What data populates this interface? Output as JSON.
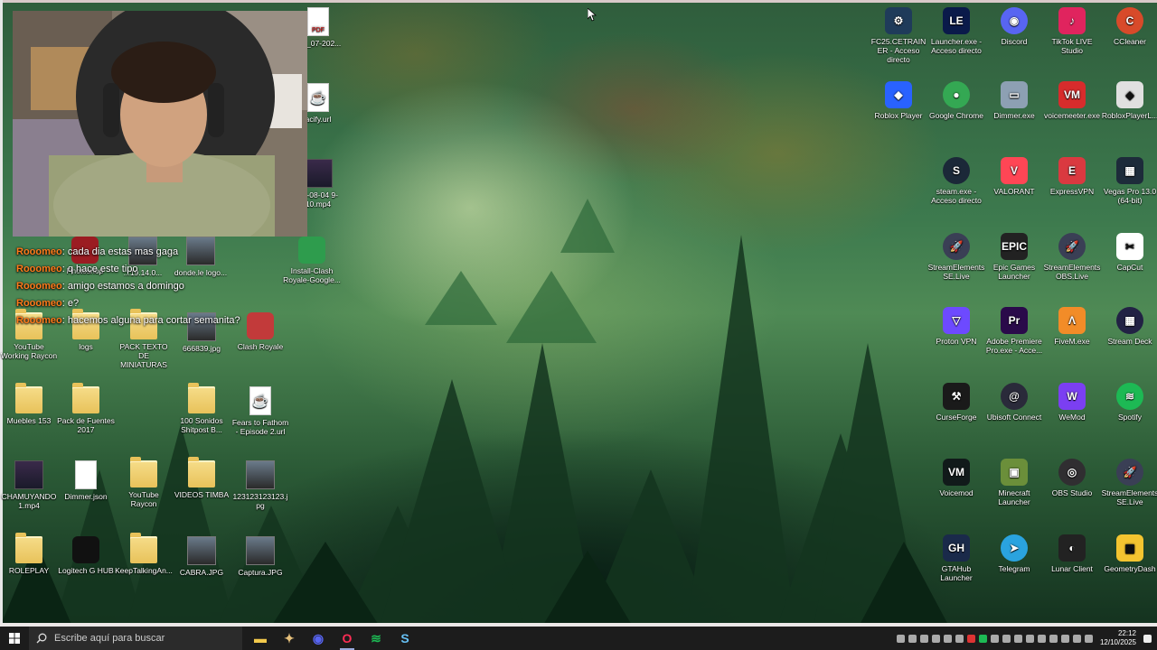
{
  "desktop": {
    "left_icons": [
      {
        "label": "ura_07-202...",
        "kind": "pdf",
        "badge": "PDF"
      },
      {
        "label": "acify.url",
        "kind": "java"
      },
      {
        "label": "25-08-04\n9-10.mp4",
        "kind": "video"
      },
      {
        "label": "Install-Clash Royale-Google...",
        "kind": "app",
        "color": "#2e9c4d"
      },
      {
        "label": "Photoshop",
        "kind": "app",
        "color": "#9b1c22"
      },
      {
        "label": "...19.14.0...",
        "kind": "image"
      },
      {
        "label": "donde.le logo...",
        "kind": "image"
      },
      {
        "label": "YouTube Working Raycon",
        "kind": "folder"
      },
      {
        "label": "logs",
        "kind": "folder"
      },
      {
        "label": "PACK TEXTO DE MINIATURAS",
        "kind": "folder"
      },
      {
        "label": "666839.jpg",
        "kind": "image"
      },
      {
        "label": "Clash Royale",
        "kind": "app",
        "color": "#c23a3a"
      },
      {
        "label": "Muebles 153",
        "kind": "folder"
      },
      {
        "label": "Pack de Fuentes 2017",
        "kind": "folder"
      },
      {
        "label": "100 Sonidos Shitpost B...",
        "kind": "folder"
      },
      {
        "label": "Fears to Fathom - Episode 2.url",
        "kind": "java"
      },
      {
        "label": "CHAMUYANDO 1.mp4",
        "kind": "video"
      },
      {
        "label": "Dimmer.json",
        "kind": "file"
      },
      {
        "label": "YouTube Raycon",
        "kind": "folder"
      },
      {
        "label": "VIDEOS TIMBA",
        "kind": "folder"
      },
      {
        "label": "123123123123.jpg",
        "kind": "image"
      },
      {
        "label": "ROLEPLAY",
        "kind": "folder"
      },
      {
        "label": "Logitech G HUB",
        "kind": "app",
        "color": "#111111"
      },
      {
        "label": "KeepTalkingAn...",
        "kind": "folder"
      },
      {
        "label": "CABRA.JPG",
        "kind": "image"
      },
      {
        "label": "Captura.JPG",
        "kind": "image"
      }
    ],
    "right_icons": [
      {
        "label": "FC25.CETRAINER - Acceso directo",
        "kind": "app",
        "color": "#1f3b5a",
        "badge": "⚙"
      },
      {
        "label": "Launcher.exe - Acceso directo",
        "kind": "app",
        "color": "#0a1a4a",
        "badge": "LE"
      },
      {
        "label": "Discord",
        "kind": "round",
        "color": "#5865F2",
        "badge": "◉"
      },
      {
        "label": "TikTok LIVE Studio",
        "kind": "app",
        "color": "#e0245e",
        "badge": "♪"
      },
      {
        "label": "CCleaner",
        "kind": "round",
        "color": "#d84a2a",
        "badge": "C"
      },
      {
        "label": "Roblox Player",
        "kind": "app",
        "color": "#2962ff",
        "badge": "◆"
      },
      {
        "label": "Google Chrome",
        "kind": "round",
        "color": "#34a853",
        "badge": "●"
      },
      {
        "label": "Dimmer.exe",
        "kind": "app",
        "color": "#8da0b3",
        "badge": "▭"
      },
      {
        "label": "voicemeeter.exe",
        "kind": "app",
        "color": "#d72c2c",
        "badge": "VM"
      },
      {
        "label": "RobloxPlayerL...",
        "kind": "app",
        "color": "#e0e0e0",
        "badge": "◆"
      },
      {
        "label": "steam.exe - Acceso directo",
        "kind": "round",
        "color": "#1b2838",
        "badge": "S"
      },
      {
        "label": "VALORANT",
        "kind": "app",
        "color": "#ff4655",
        "badge": "V"
      },
      {
        "label": "ExpressVPN",
        "kind": "app",
        "color": "#da3940",
        "badge": "E"
      },
      {
        "label": "Vegas Pro 13.0 (64-bit)",
        "kind": "app",
        "color": "#1d2b3a",
        "badge": "▦"
      },
      {
        "label": "StreamElements SE.Live",
        "kind": "round",
        "color": "#3a3f55",
        "badge": "🚀"
      },
      {
        "label": "Epic Games Launcher",
        "kind": "app",
        "color": "#222222",
        "badge": "EPIC"
      },
      {
        "label": "StreamElements OBS.Live",
        "kind": "round",
        "color": "#3a3f55",
        "badge": "🚀"
      },
      {
        "label": "CapCut",
        "kind": "app",
        "color": "#ffffff",
        "badge": "✂"
      },
      {
        "label": "Proton VPN",
        "kind": "app",
        "color": "#6d4aff",
        "badge": "▽"
      },
      {
        "label": "Adobe Premiere Pro.exe - Acce...",
        "kind": "app",
        "color": "#2a0a4a",
        "badge": "Pr"
      },
      {
        "label": "FiveM.exe",
        "kind": "app",
        "color": "#f28c28",
        "badge": "Λ"
      },
      {
        "label": "Stream Deck",
        "kind": "round",
        "color": "#222244",
        "badge": "▦"
      },
      {
        "label": "CurseForge",
        "kind": "app",
        "color": "#1a1a1a",
        "badge": "⚒"
      },
      {
        "label": "Ubisoft Connect",
        "kind": "round",
        "color": "#2a2a3a",
        "badge": "@"
      },
      {
        "label": "WeMod",
        "kind": "app",
        "color": "#7b3ff2",
        "badge": "W"
      },
      {
        "label": "Spotify",
        "kind": "round",
        "color": "#1db954",
        "badge": "≋"
      },
      {
        "label": "Voicemod",
        "kind": "app",
        "color": "#111a1a",
        "badge": "VM"
      },
      {
        "label": "Minecraft Launcher",
        "kind": "app",
        "color": "#6b8f3a",
        "badge": "▣"
      },
      {
        "label": "OBS Studio",
        "kind": "round",
        "color": "#302e31",
        "badge": "◎"
      },
      {
        "label": "StreamElements SE.Live",
        "kind": "round",
        "color": "#3a3f55",
        "badge": "🚀"
      },
      {
        "label": "GTAHub Launcher",
        "kind": "app",
        "color": "#1a2a4a",
        "badge": "GH"
      },
      {
        "label": "Telegram",
        "kind": "round",
        "color": "#2aa3df",
        "badge": "➤"
      },
      {
        "label": "Lunar Client",
        "kind": "app",
        "color": "#222222",
        "badge": "◐"
      },
      {
        "label": "GeometryDash",
        "kind": "app",
        "color": "#f4c430",
        "badge": "▩"
      }
    ]
  },
  "chat": [
    {
      "user": "Rooomeo",
      "text": ": cada dia estas mas gaga"
    },
    {
      "user": "Rooomeo",
      "text": ": q hace este tipo"
    },
    {
      "user": "Rooomeo",
      "text": ": amigo estamos a domingo"
    },
    {
      "user": "Rooomeo",
      "text": ": e?"
    },
    {
      "user": "Rooomeo",
      "text": ": hacemos alguna para cortar semanita?"
    }
  ],
  "taskbar": {
    "search_placeholder": "Escribe aquí para buscar",
    "apps": [
      {
        "name": "file-explorer",
        "glyph": "▬",
        "color": "#f2c94c",
        "active": false
      },
      {
        "name": "streamelements",
        "glyph": "✦",
        "color": "#e6c07b",
        "active": false
      },
      {
        "name": "discord",
        "glyph": "◉",
        "color": "#5865F2",
        "active": false
      },
      {
        "name": "opera-gx",
        "glyph": "O",
        "color": "#ff2d55",
        "active": true
      },
      {
        "name": "spotify",
        "glyph": "≋",
        "color": "#1db954",
        "active": false
      },
      {
        "name": "steam",
        "glyph": "S",
        "color": "#66c0f4",
        "active": false
      }
    ],
    "time": "22:12",
    "date": "12/10/2025"
  }
}
